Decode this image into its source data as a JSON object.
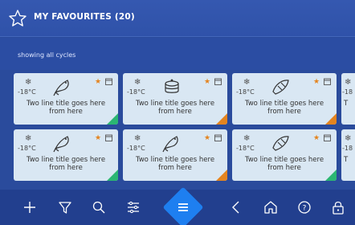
{
  "header": {
    "title": "MY FAVOURITES (20)"
  },
  "subheader": {
    "text": "showing all cycles"
  },
  "cards": [
    {
      "temp": "-18°C",
      "title": "Two line title goes here from here",
      "icon": "fish-icon",
      "accent": "#2bb673"
    },
    {
      "temp": "-18°C",
      "title": "Two line title goes here from here",
      "icon": "cake-icon",
      "accent": "#e4841f"
    },
    {
      "temp": "-18°C",
      "title": "Two line title goes here from here",
      "icon": "croissant-icon",
      "accent": "#e4841f"
    },
    {
      "temp": "-18",
      "title": "T",
      "icon": "snowflake-icon",
      "accent": "#2bb673"
    },
    {
      "temp": "-18°C",
      "title": "Two line title goes here from here",
      "icon": "fish-icon",
      "accent": "#2bb673"
    },
    {
      "temp": "-18°C",
      "title": "Two line title goes here from here",
      "icon": "fish-icon",
      "accent": "#e4841f"
    },
    {
      "temp": "-18°C",
      "title": "Two line title goes here from here",
      "icon": "croissant-icon",
      "accent": "#2bb673"
    },
    {
      "temp": "-18",
      "title": "T",
      "icon": "snowflake-icon",
      "accent": "#2bb673"
    }
  ],
  "footer": {
    "buttons": [
      "add-icon",
      "filter-icon",
      "search-icon",
      "settings-icon",
      "menu-icon",
      "back-icon",
      "home-icon",
      "help-icon",
      "lock-icon"
    ]
  },
  "colors": {
    "accent_blue": "#1e7ff0",
    "background": "#2a4b9c",
    "favourite": "#e4841f",
    "green": "#2bb673"
  }
}
